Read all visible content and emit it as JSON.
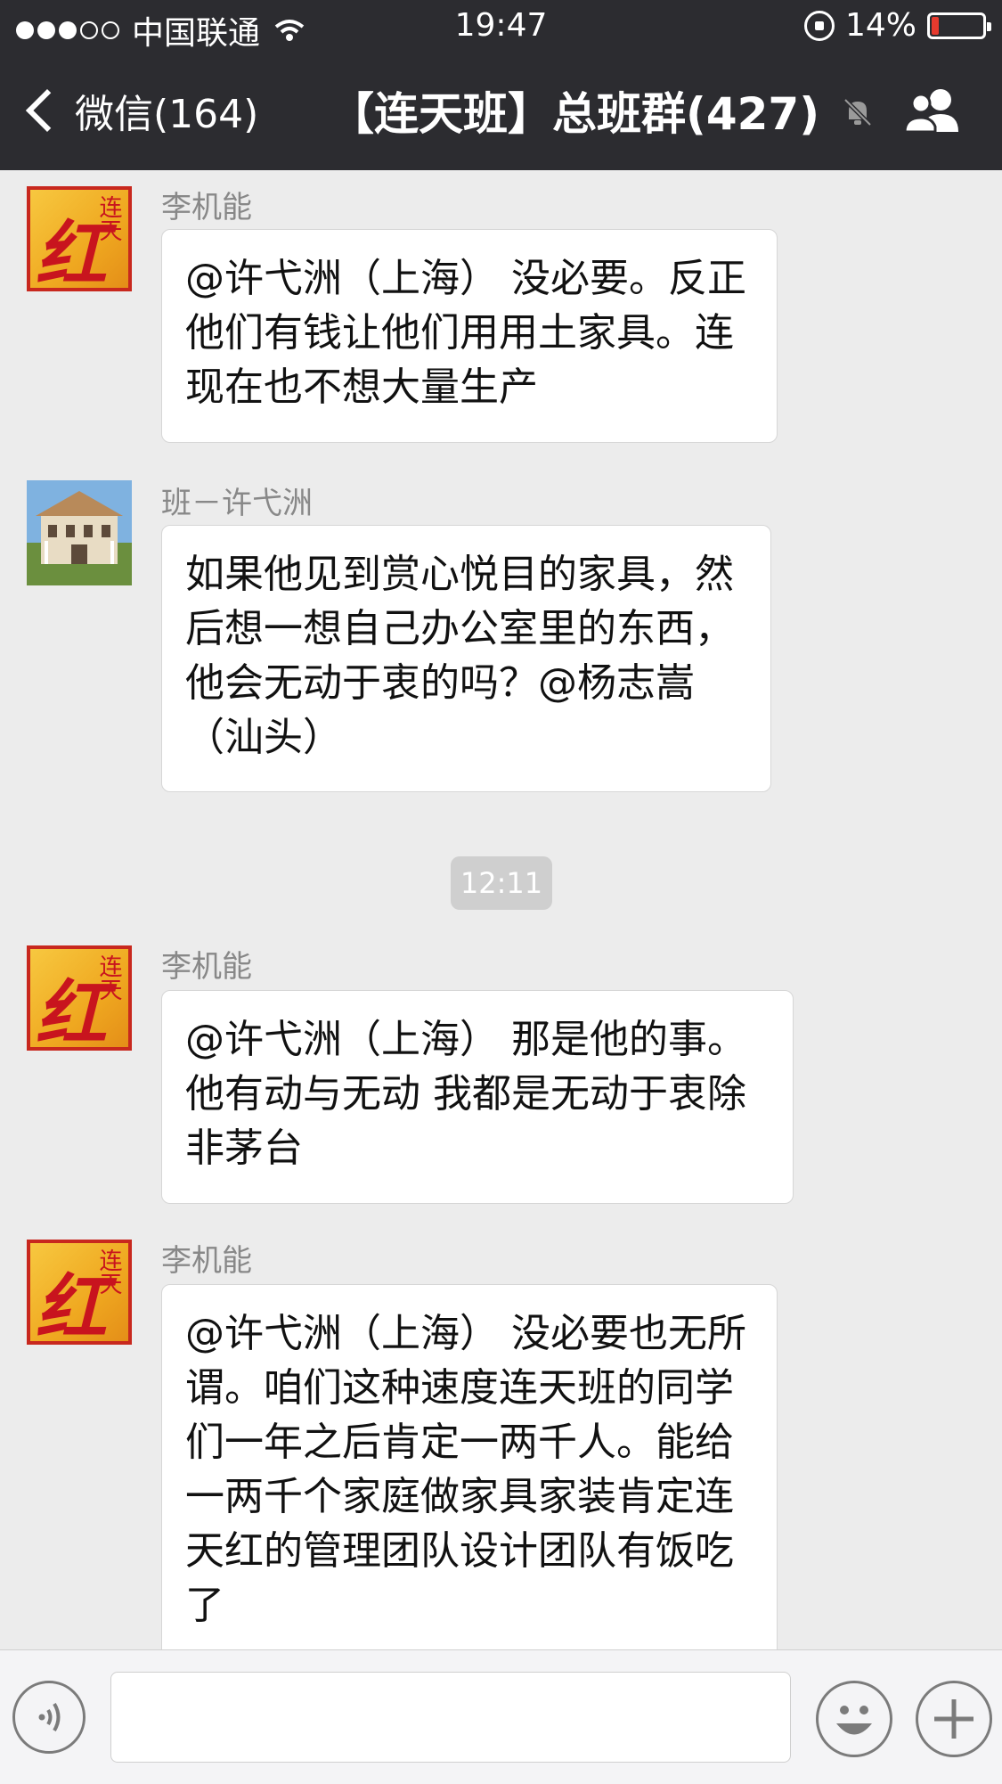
{
  "status_bar": {
    "carrier": "中国联通",
    "time": "19:47",
    "battery": "14%",
    "battery_level": 0.14,
    "battery_color": "#e63a2e"
  },
  "nav": {
    "back_label": "微信(164)",
    "title": "【连天班】总班群(427)",
    "icons": [
      "back-chevron-icon",
      "mute-bell-icon",
      "group-members-icon"
    ]
  },
  "messages": [
    {
      "sender": "李机能",
      "avatar": "red-calligraphy-avatar",
      "text": "@许弋洲（上海） 没必要。反正他们有钱让他们用用土家具。连现在也不想大量生产"
    },
    {
      "sender": "班－许弋洲",
      "avatar": "house-photo-avatar",
      "text": "如果他见到赏心悦目的家具，然后想一想自己办公室里的东西，他会无动于衷的吗？@杨志嵩（汕头）"
    },
    {
      "sender": "李机能",
      "avatar": "red-calligraphy-avatar",
      "text": "@许弋洲（上海） 那是他的事。他有动与无动  我都是无动于衷除非茅台"
    },
    {
      "sender": "李机能",
      "avatar": "red-calligraphy-avatar",
      "text": "@许弋洲（上海） 没必要也无所谓。咱们这种速度连天班的同学们一年之后肯定一两千人。能给一两千个家庭做家具家装肯定连天红的管理团队设计团队有饭吃了"
    }
  ],
  "timestamp_divider": "12:11",
  "input_bar": {
    "icons": [
      "voice-icon",
      "emoji-icon",
      "plus-icon"
    ]
  }
}
